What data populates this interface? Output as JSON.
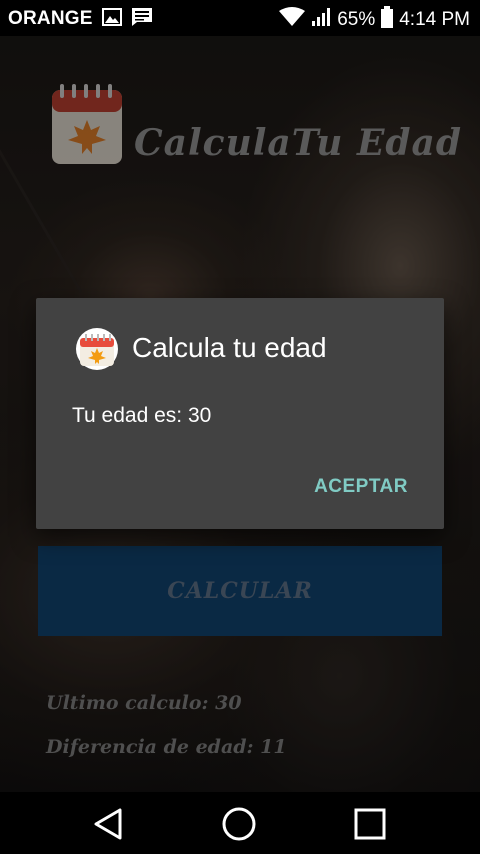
{
  "status_bar": {
    "carrier": "ORANGE",
    "battery": "65%",
    "time": "4:14 PM",
    "icons": [
      "image-icon",
      "message-icon",
      "wifi-icon",
      "signal-icon",
      "battery-icon"
    ]
  },
  "app": {
    "title": "CalculaTu Edad",
    "calculate_button": "CALCULAR",
    "last_calc": "Ultimo calculo: 30",
    "age_diff": "Diferencia de edad: 11",
    "brand_color": "#0a2944"
  },
  "dialog": {
    "title": "Calcula tu edad",
    "message": "Tu edad es: 30",
    "accept_label": "ACEPTAR",
    "accept_color": "#80cbc4"
  },
  "nav_bar": {
    "icons": [
      "back-icon",
      "home-icon",
      "recents-icon"
    ]
  }
}
